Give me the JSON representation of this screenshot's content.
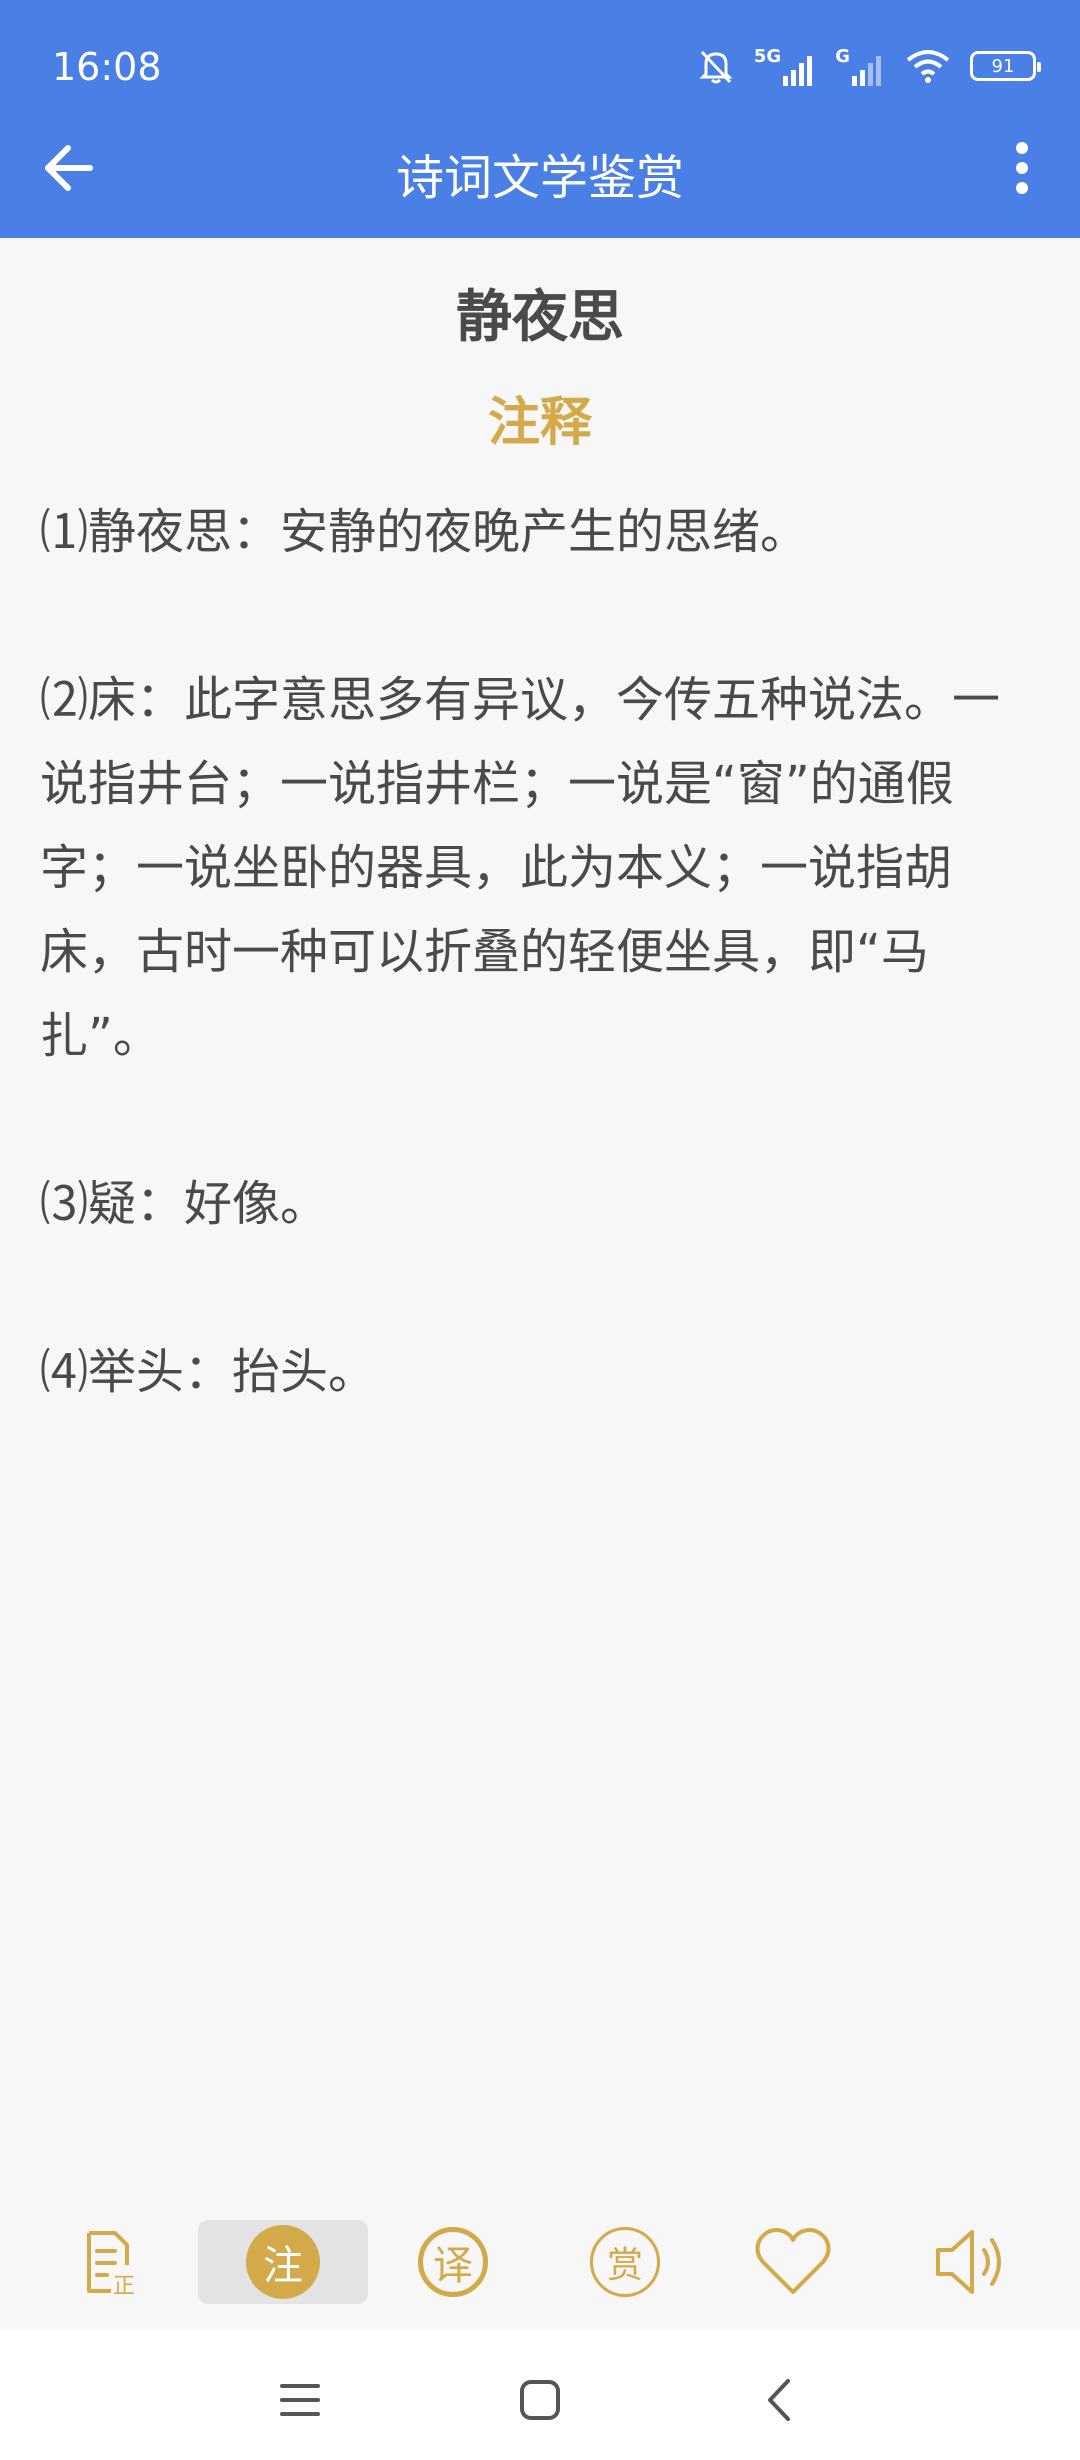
{
  "status_bar": {
    "time": "16:08",
    "signal1_label": "5G",
    "signal2_label": "G",
    "battery": "91"
  },
  "toolbar": {
    "title": "诗词文学鉴赏"
  },
  "poem": {
    "title": "静夜思",
    "section": "注释"
  },
  "notes": [
    "⑴静夜思：安静的夜晚产生的思绪。",
    "⑵床：此字意思多有异议，今传五种说法。一说指井台；一说指井栏；一说是“窗”的通假字；一说坐卧的器具，此为本义；一说指胡床，古时一种可以折叠的轻便坐具，即“马扎”。",
    "⑶疑：好像。",
    "⑷举头：抬头。"
  ],
  "bottom_bar": {
    "items": [
      {
        "name": "original-text",
        "icon": "document-zheng-icon",
        "glyph": "正"
      },
      {
        "name": "notes",
        "icon": "zhu-circle-icon",
        "glyph": "注",
        "selected": true
      },
      {
        "name": "translation",
        "icon": "yi-circle-icon",
        "glyph": "译"
      },
      {
        "name": "appreciation",
        "icon": "shang-circle-icon",
        "glyph": "赏"
      },
      {
        "name": "favorite",
        "icon": "heart-icon"
      },
      {
        "name": "read-aloud",
        "icon": "speaker-icon"
      }
    ]
  },
  "colors": {
    "app_bar": "#4a7fe6",
    "accent_gold": "#d3a94a",
    "text": "#4a4a4a"
  }
}
